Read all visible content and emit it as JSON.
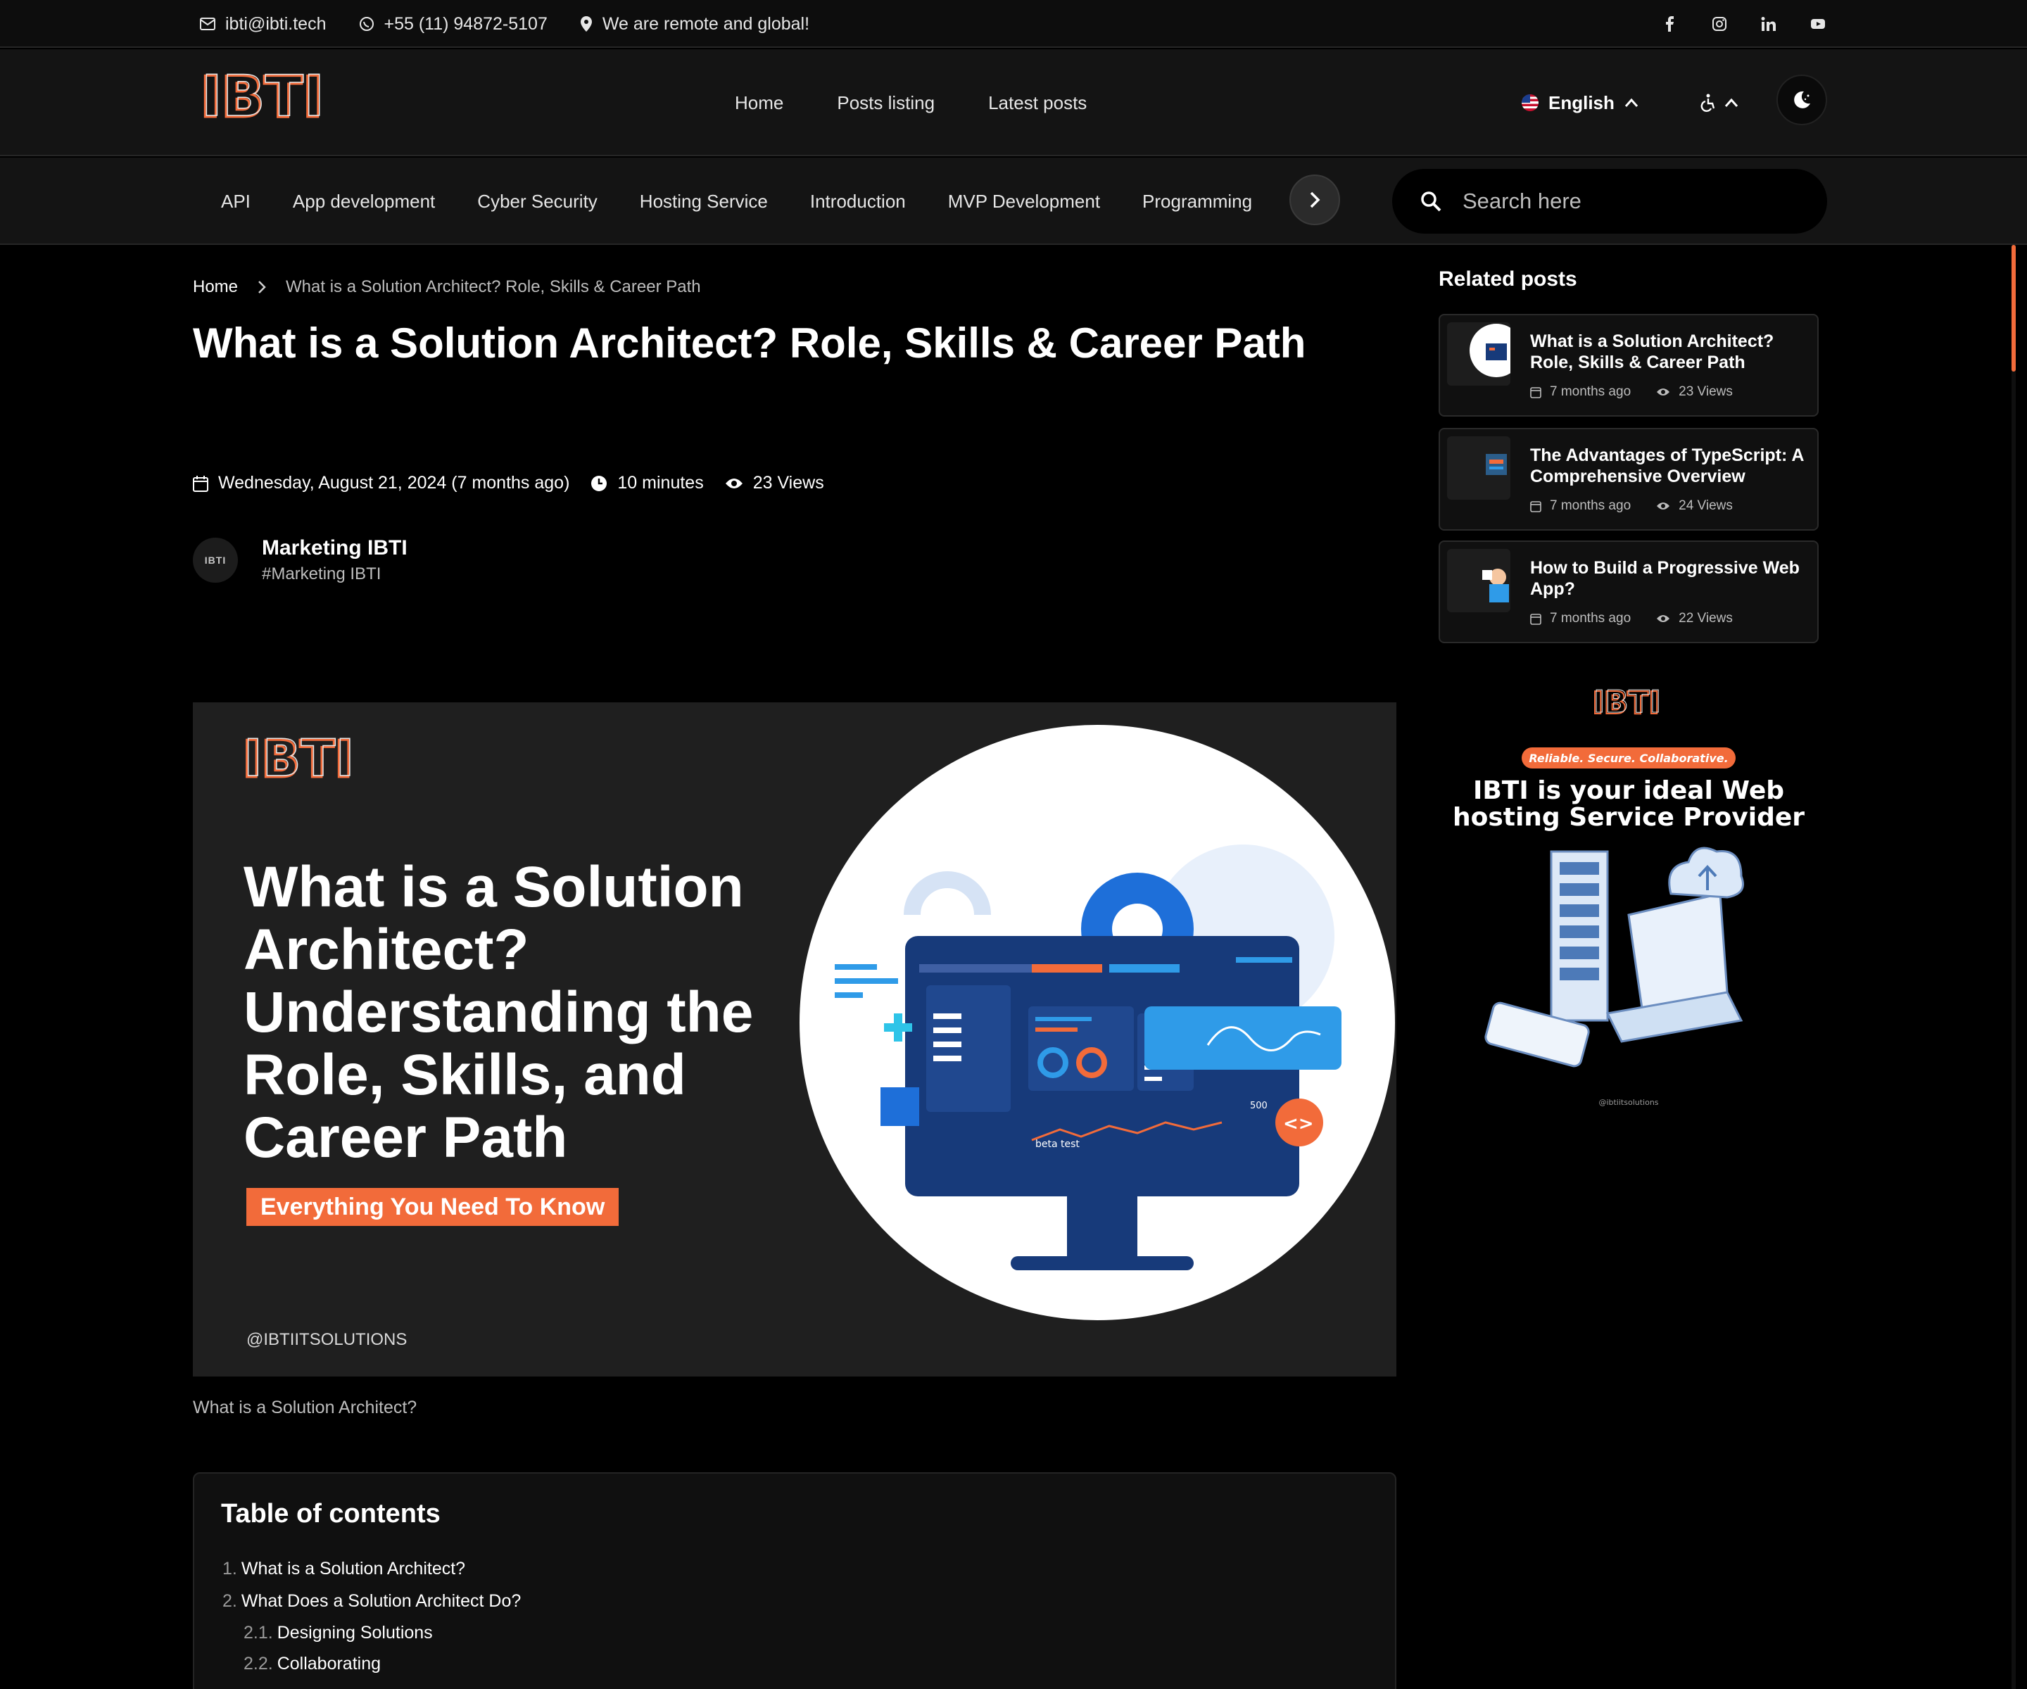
{
  "topbar": {
    "email": "ibti@ibti.tech",
    "phone": "+55 (11) 94872-5107",
    "location": "We are remote and global!",
    "social": [
      "facebook-icon",
      "instagram-icon",
      "linkedin-icon",
      "youtube-icon"
    ]
  },
  "header": {
    "logo_text": "IBTI",
    "nav": [
      "Home",
      "Posts listing",
      "Latest posts"
    ],
    "language": "English"
  },
  "categories": [
    "API",
    "App development",
    "Cyber Security",
    "Hosting Service",
    "Introduction",
    "MVP Development",
    "Programming"
  ],
  "search": {
    "placeholder": "Search here"
  },
  "breadcrumb": {
    "home": "Home",
    "current": "What is a Solution Architect? Role, Skills & Career Path"
  },
  "article": {
    "title": "What is a Solution Architect? Role, Skills & Career Path",
    "date": "Wednesday, August 21, 2024 (7 months ago)",
    "read_time": "10 minutes",
    "views": "23 Views",
    "author": {
      "name": "Marketing IBTI",
      "handle": "#Marketing IBTI",
      "avatar_text": "IBTI"
    },
    "hero": {
      "title": "What is a Solution Architect? Understanding the Role, Skills, and Career Path",
      "badge": "Everything You Need To  Know",
      "handle": "@IBTIITSOLUTIONS",
      "chart_text_1": "beta test",
      "chart_text_2": "500"
    },
    "caption": "What is a Solution Architect?"
  },
  "toc": {
    "title": "Table of contents",
    "items": [
      {
        "num": "1.",
        "label": "What is a Solution Architect?"
      },
      {
        "num": "2.",
        "label": "What Does a Solution Architect Do?"
      },
      {
        "num": "2.1.",
        "label": "Designing Solutions"
      },
      {
        "num": "2.2.",
        "label": "Collaborating"
      }
    ]
  },
  "sidebar": {
    "related_title": "Related posts",
    "posts": [
      {
        "title": "What is a Solution Architect? Role, Skills & Career Path",
        "time": "7 months ago",
        "views": "23 Views"
      },
      {
        "title": "The Advantages of TypeScript: A Comprehensive Overview",
        "time": "7 months ago",
        "views": "24 Views"
      },
      {
        "title": "How to Build a Progressive Web App?",
        "time": "7 months ago",
        "views": "22 Views"
      }
    ],
    "ad": {
      "logo": "IBTI",
      "tagline": "Reliable. Secure. Collaborative.",
      "headline_1": "IBTI is your ideal Web",
      "headline_2": "hosting Service Provider",
      "handle": "@ibtiitsolutions"
    }
  },
  "colors": {
    "accent": "#f26b3a",
    "background": "#000000",
    "surface": "#141414"
  }
}
